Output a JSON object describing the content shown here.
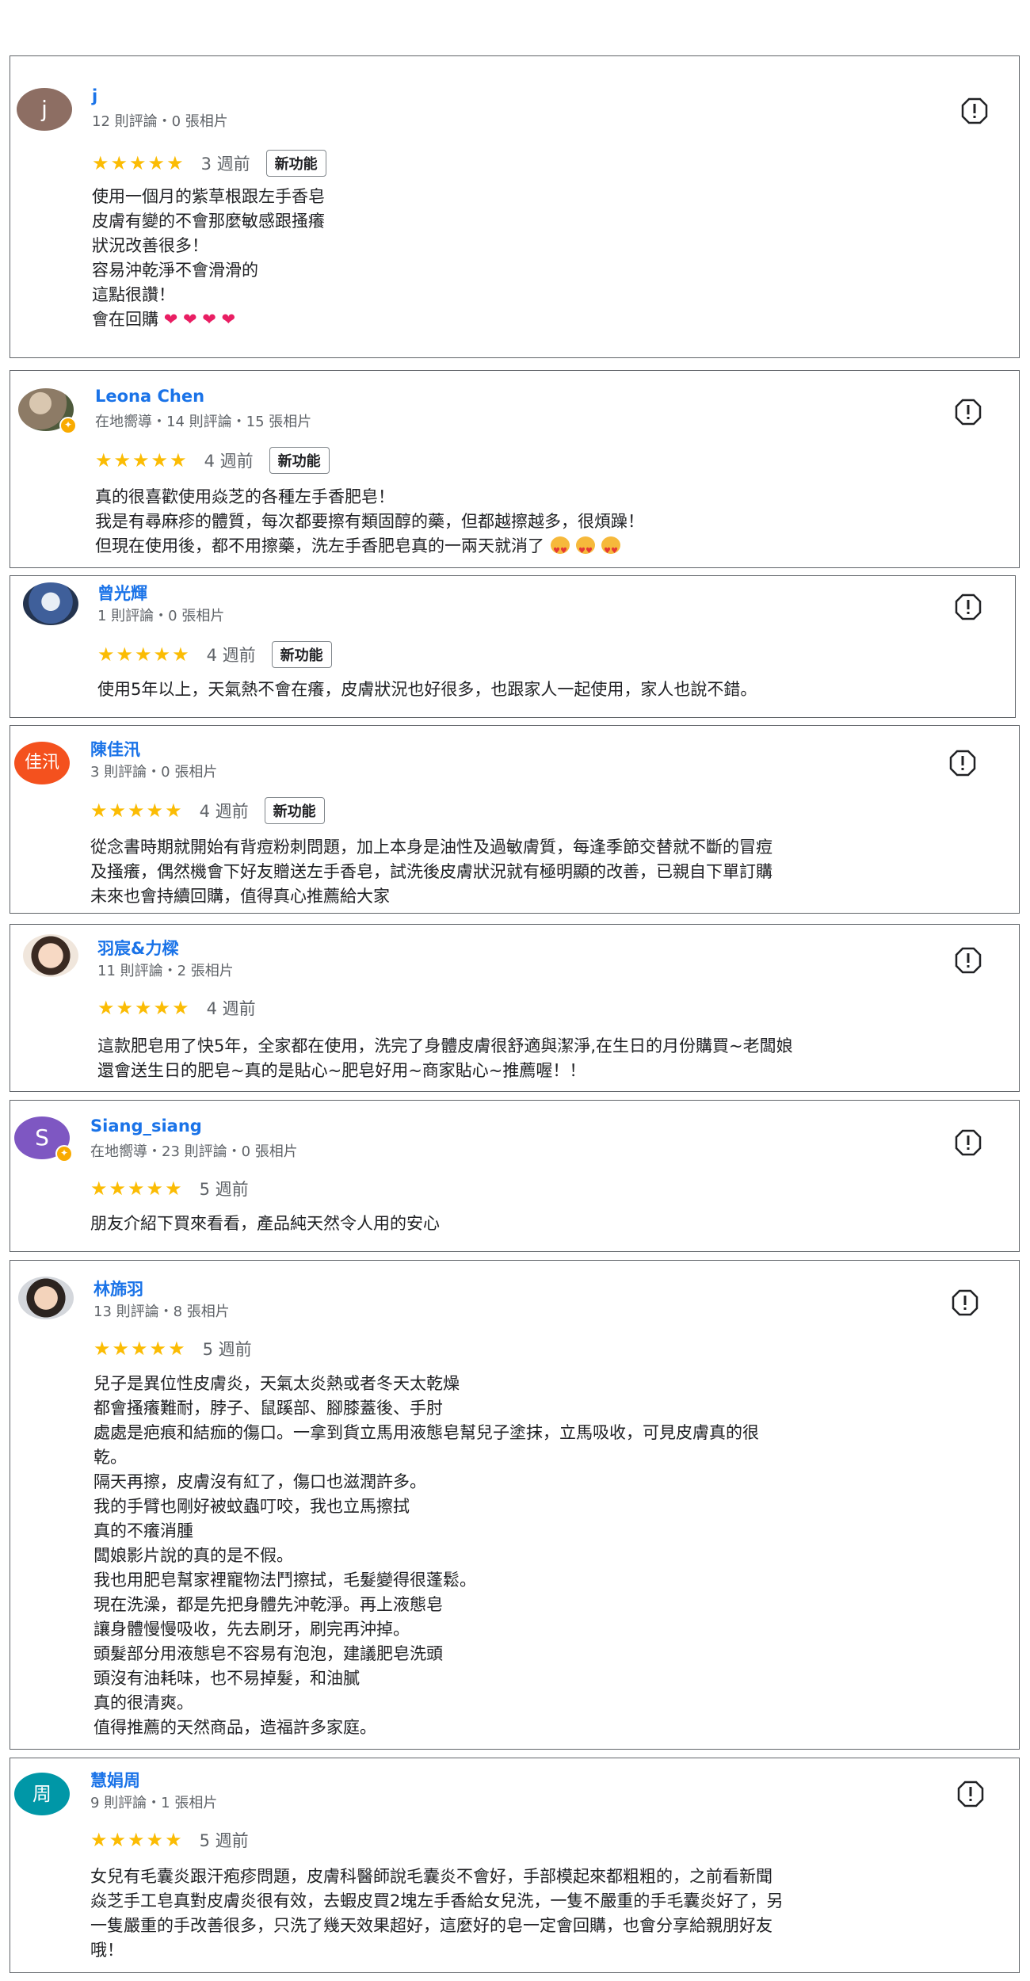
{
  "colors": {
    "name_link": "#1a73e8",
    "star": "#fbbc04",
    "meta": "#5f6368",
    "border": "#5f6368"
  },
  "reviews": [
    {
      "avatar": {
        "type": "letter",
        "letter": "j",
        "bg": "#8d6e63",
        "local_guide": false
      },
      "name": "j",
      "meta": "12 則評論・0 張相片",
      "stars": "★★★★★",
      "ago": "3 週前",
      "badge": "新功能",
      "lines": [
        "使用一個月的紫草根跟左手香皂",
        "皮膚有變的不會那麼敏感跟搔癢",
        "狀況改善很多！",
        "容易沖乾淨不會滑滑的",
        "這點很讚！",
        "會在回購"
      ],
      "hearts": "❤ ❤ ❤ ❤"
    },
    {
      "avatar": {
        "type": "photo",
        "local_guide": true
      },
      "name": "Leona Chen",
      "meta": "在地嚮導・14 則評論・15 張相片",
      "stars": "★★★★★",
      "ago": "4 週前",
      "badge": "新功能",
      "lines": [
        "真的很喜歡使用焱芝的各種左手香肥皂！",
        "我是有尋麻疹的體質，每次都要擦有類固醇的藥，但都越擦越多，很煩躁！",
        "但現在使用後，都不用擦藥，洗左手香肥皂真的一兩天就消了"
      ]
    },
    {
      "avatar": {
        "type": "photo",
        "local_guide": false
      },
      "name": "曾光輝",
      "meta": "1 則評論・0 張相片",
      "stars": "★★★★★",
      "ago": "4 週前",
      "badge": "新功能",
      "lines": [
        "使用5年以上，天氣熱不會在癢，皮膚狀況也好很多，也跟家人一起使用，家人也說不錯。"
      ]
    },
    {
      "avatar": {
        "type": "letter",
        "letter": "佳汛",
        "bg": "#f4511e",
        "local_guide": false
      },
      "name": "陳佳汛",
      "meta": "3 則評論・0 張相片",
      "stars": "★★★★★",
      "ago": "4 週前",
      "badge": "新功能",
      "lines": [
        "從念書時期就開始有背痘粉刺問題，加上本身是油性及過敏膚質，每逢季節交替就不斷的冒痘",
        "及搔癢，偶然機會下好友贈送左手香皂，試洗後皮膚狀況就有極明顯的改善，已親自下單訂購",
        "未來也會持續回購，值得真心推薦給大家"
      ]
    },
    {
      "avatar": {
        "type": "photo",
        "local_guide": false
      },
      "name": "羽宸&力樑",
      "meta": "11 則評論・2 張相片",
      "stars": "★★★★★",
      "ago": "4 週前",
      "lines": [
        "這款肥皂用了快5年，全家都在使用，洗完了身體皮膚很舒適與潔淨,在生日的月份購買~老闆娘",
        "還會送生日的肥皂~真的是貼心~肥皂好用~商家貼心~推薦喔！！"
      ]
    },
    {
      "avatar": {
        "type": "letter",
        "letter": "S",
        "bg": "#7e57c2",
        "local_guide": true
      },
      "name": "Siang_siang",
      "meta": "在地嚮導・23 則評論・0 張相片",
      "stars": "★★★★★",
      "ago": "5 週前",
      "lines": [
        "朋友介紹下買來看看，產品純天然令人用的安心"
      ]
    },
    {
      "avatar": {
        "type": "photo",
        "local_guide": false
      },
      "name": "林旆羽",
      "meta": "13 則評論・8 張相片",
      "stars": "★★★★★",
      "ago": "5 週前",
      "lines": [
        "兒子是異位性皮膚炎，天氣太炎熱或者冬天太乾燥",
        "都會搔癢難耐，脖子、鼠蹊部、腳膝蓋後、手肘",
        "處處是疤痕和結痂的傷口。一拿到貨立馬用液態皂幫兒子塗抹，立馬吸收，可見皮膚真的很",
        "乾。",
        "隔天再擦，皮膚沒有紅了，傷口也滋潤許多。",
        "我的手臂也剛好被蚊蟲叮咬，我也立馬擦拭",
        "真的不癢消腫",
        "闆娘影片說的真的是不假。",
        "我也用肥皂幫家裡寵物法鬥擦拭，毛髮變得很蓬鬆。",
        "現在洗澡，都是先把身體先沖乾淨。再上液態皂",
        "讓身體慢慢吸收，先去刷牙，刷完再沖掉。",
        "頭髮部分用液態皂不容易有泡泡，建議肥皂洗頭",
        "頭沒有油耗味，也不易掉髮，和油膩",
        "真的很清爽。",
        "值得推薦的天然商品，造福許多家庭。"
      ]
    },
    {
      "avatar": {
        "type": "letter",
        "letter": "周",
        "bg": "#0097a7",
        "local_guide": false
      },
      "name": "慧娟周",
      "meta": "9 則評論・1 張相片",
      "stars": "★★★★★",
      "ago": "5 週前",
      "lines": [
        "女兒有毛囊炎跟汗疱疹問題，皮膚科醫師說毛囊炎不會好，手部模起來都粗粗的，之前看新聞",
        "焱芝手工皂真對皮膚炎很有效，去蝦皮買2塊左手香給女兒洗，一隻不嚴重的手毛囊炎好了，另",
        "一隻嚴重的手改善很多，只洗了幾天效果超好，這麼好的皂一定會回購，也會分享給親朋好友",
        "哦！"
      ]
    }
  ]
}
